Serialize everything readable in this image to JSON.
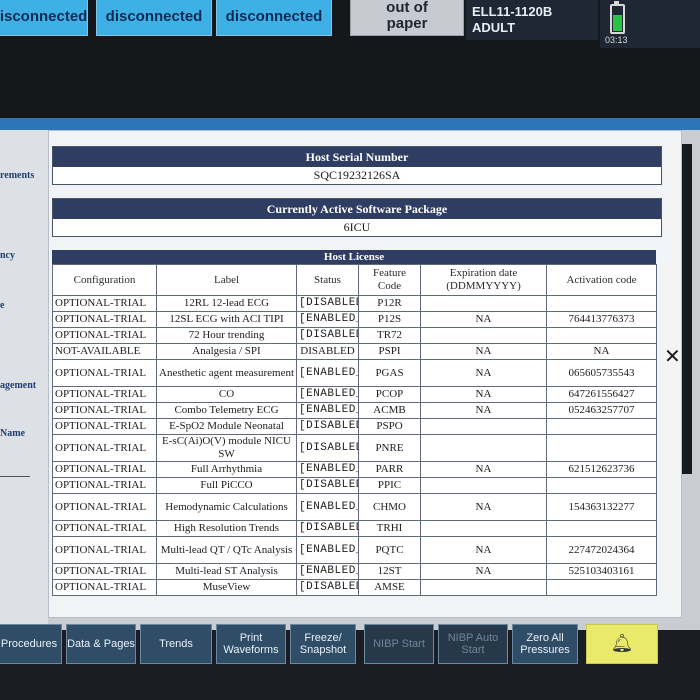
{
  "topbar": {
    "tiles": [
      {
        "label": "disconnected"
      },
      {
        "label": "disconnected"
      },
      {
        "label": "disconnected"
      }
    ],
    "printer": {
      "line1": "out of",
      "line2": "paper"
    },
    "patient": {
      "bed": "ELL11-1120B",
      "category": "ADULT"
    },
    "clock": "03:13",
    "battery_level": 0.6
  },
  "left_labels": [
    "rements",
    "ncy",
    "e",
    "agement",
    "Name"
  ],
  "serial": {
    "title": "Host Serial Number",
    "value": "SQC19232126SA"
  },
  "software": {
    "title": "Currently Active Software Package",
    "value": "6ICU"
  },
  "license": {
    "title": "Host License",
    "headers": [
      "Configuration",
      "Label",
      "Status",
      "Feature Code",
      "Expiration date (DDMMYYYY)",
      "Activation code"
    ],
    "rows": [
      [
        "OPTIONAL-TRIAL",
        "12RL 12-lead ECG",
        "[DISABLED]",
        "P12R",
        "",
        ""
      ],
      [
        "OPTIONAL-TRIAL",
        "12SL ECG with ACI TIPI",
        "[ENABLED_]",
        "P12S",
        "NA",
        "764413776373"
      ],
      [
        "OPTIONAL-TRIAL",
        "72 Hour trending",
        "[DISABLED]",
        "TR72",
        "",
        ""
      ],
      [
        "NOT-AVAILABLE",
        "Analgesia / SPI",
        "DISABLED",
        "PSPI",
        "NA",
        "NA"
      ],
      [
        "OPTIONAL-TRIAL",
        "Anesthetic agent measurement",
        "[ENABLED_]",
        "PGAS",
        "NA",
        "065605735543"
      ],
      [
        "OPTIONAL-TRIAL",
        "CO",
        "[ENABLED_]",
        "PCOP",
        "NA",
        "647261556427"
      ],
      [
        "OPTIONAL-TRIAL",
        "Combo Telemetry ECG",
        "[ENABLED_]",
        "ACMB",
        "NA",
        "052463257707"
      ],
      [
        "OPTIONAL-TRIAL",
        "E-SpO2 Module Neonatal",
        "[DISABLED]",
        "PSPO",
        "",
        ""
      ],
      [
        "OPTIONAL-TRIAL",
        "E-sC(Ai)O(V) module NICU SW",
        "[DISABLED]",
        "PNRE",
        "",
        ""
      ],
      [
        "OPTIONAL-TRIAL",
        "Full Arrhythmia",
        "[ENABLED_]",
        "PARR",
        "NA",
        "621512623736"
      ],
      [
        "OPTIONAL-TRIAL",
        "Full PiCCO",
        "[DISABLED]",
        "PPIC",
        "",
        ""
      ],
      [
        "OPTIONAL-TRIAL",
        "Hemodynamic Calculations",
        "[ENABLED_]",
        "CHMO",
        "NA",
        "154363132277"
      ],
      [
        "OPTIONAL-TRIAL",
        "High Resolution Trends",
        "[DISABLED]",
        "TRHI",
        "",
        ""
      ],
      [
        "OPTIONAL-TRIAL",
        "Multi-lead QT / QTc Analysis",
        "[ENABLED_]",
        "PQTC",
        "NA",
        "227472024364"
      ],
      [
        "OPTIONAL-TRIAL",
        "Multi-lead ST Analysis",
        "[ENABLED_]",
        "12ST",
        "NA",
        "525103403161"
      ],
      [
        "OPTIONAL-TRIAL",
        "MuseView",
        "[DISABLED]",
        "AMSE",
        "",
        ""
      ]
    ]
  },
  "bottom_buttons": [
    {
      "label": "Procedures"
    },
    {
      "label": "Data & Pages"
    },
    {
      "label": "Trends"
    },
    {
      "label": "Print Waveforms"
    },
    {
      "label": "Freeze/ Snapshot"
    },
    {
      "label": "NIBP Start"
    },
    {
      "label": "NIBP Auto Start"
    },
    {
      "label": "Zero All Pressures"
    },
    {
      "icon": "bell-icon"
    }
  ],
  "colors": {
    "accent_blue": "#3fb0e6",
    "header_navy": "#2f3d63",
    "alarm_yellow": "#e9ea6a"
  }
}
